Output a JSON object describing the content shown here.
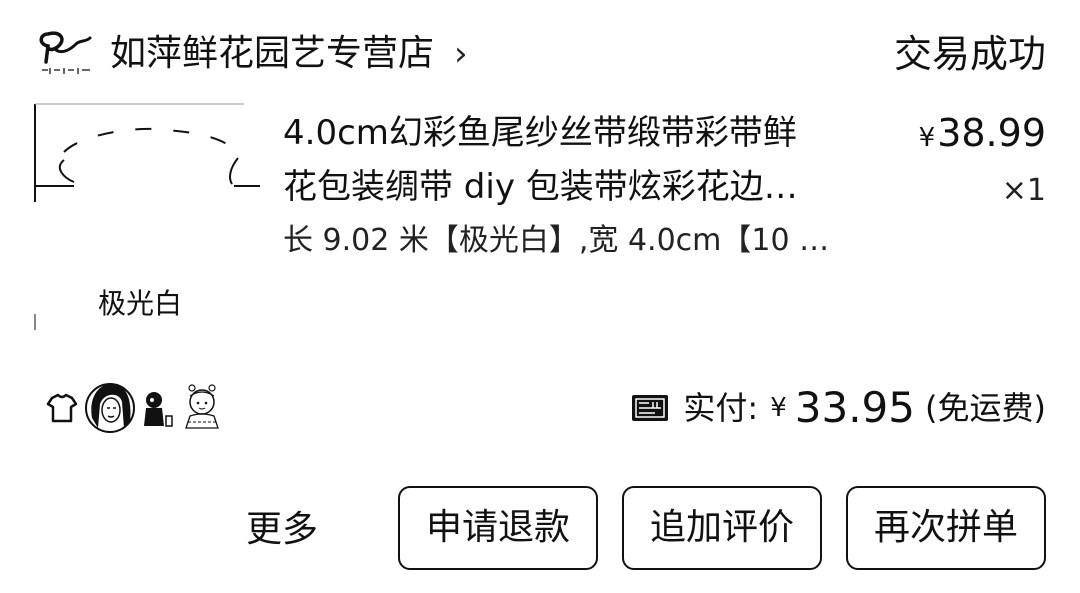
{
  "header": {
    "store_name": "如萍鲜花园艺专营店",
    "chevron": "›",
    "status": "交易成功",
    "logo_icon": "store-logo-icon"
  },
  "product": {
    "title_line1": "4.0cm幻彩鱼尾纱丝带缎带彩带鲜",
    "title_line2": "花包装绸带 diy 包装带炫彩花边…",
    "sku": "长 9.02 米【极光白】,宽 4.0cm【10 …",
    "price_symbol": "¥",
    "price": "38.99",
    "quantity": "×1",
    "thumbnail_caption": "极光白"
  },
  "buyers": {
    "avatar_icons": [
      "shirt-avatar-icon",
      "woman-portrait-avatar-icon",
      "figure-avatar-icon",
      "cartoon-girl-avatar-icon"
    ]
  },
  "payment": {
    "badge_icon": "coupon-badge-icon",
    "label": "实付:",
    "symbol": "¥",
    "amount": "33.95",
    "shipping": "(免运费)"
  },
  "actions": {
    "more": "更多",
    "refund": "申请退款",
    "review": "追加评价",
    "reorder": "再次拼单"
  }
}
